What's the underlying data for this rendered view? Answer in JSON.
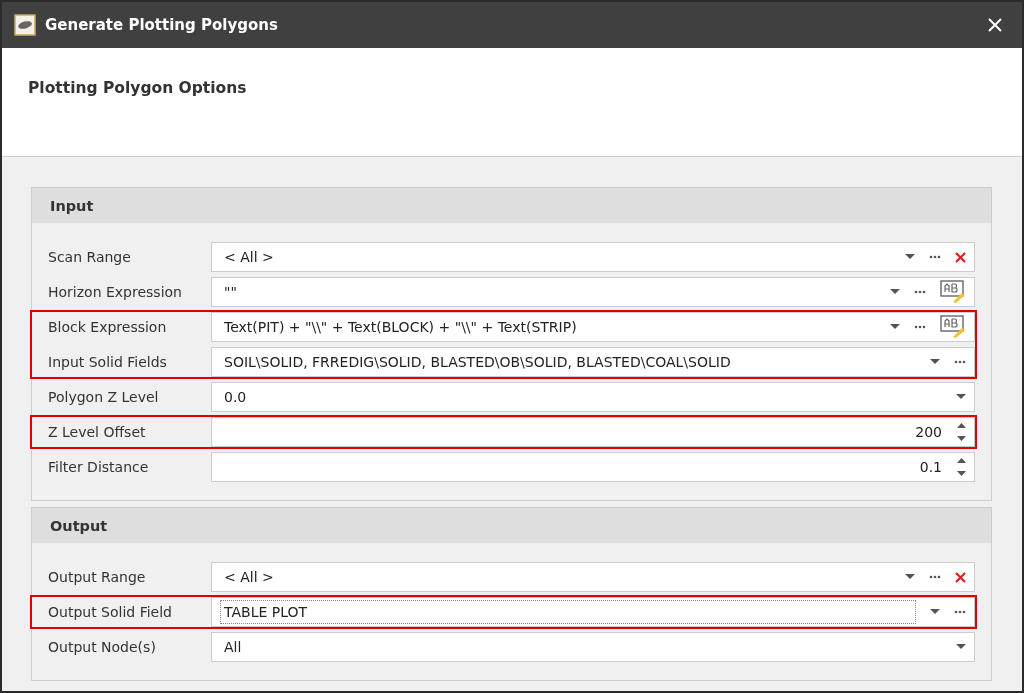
{
  "window": {
    "title": "Generate Plotting Polygons"
  },
  "header": {
    "title": "Plotting Polygon Options"
  },
  "sections": [
    {
      "title": "Input",
      "groups": [
        {
          "highlighted": false,
          "rows": [
            {
              "label": "Scan Range",
              "value": "< All >",
              "kind": "text",
              "focused": false,
              "buttons": [
                {
                  "kind": "dropdown"
                },
                {
                  "kind": "ellipsis"
                },
                {
                  "kind": "clear"
                }
              ]
            },
            {
              "label": "Horizon Expression",
              "value": "\"\"",
              "kind": "text",
              "focused": false,
              "buttons": [
                {
                  "kind": "dropdown"
                },
                {
                  "kind": "ellipsis"
                },
                {
                  "kind": "edit"
                }
              ]
            }
          ]
        },
        {
          "highlighted": true,
          "rows": [
            {
              "label": "Block Expression",
              "value": "Text(PIT) + \"\\\\\" + Text(BLOCK) + \"\\\\\" + Text(STRIP)",
              "kind": "text",
              "focused": false,
              "buttons": [
                {
                  "kind": "dropdown"
                },
                {
                  "kind": "ellipsis"
                },
                {
                  "kind": "edit"
                }
              ]
            },
            {
              "label": "Input Solid Fields",
              "value": "SOIL\\SOLID, FRREDIG\\SOLID, BLASTED\\OB\\SOLID, BLASTED\\COAL\\SOLID",
              "kind": "text",
              "focused": false,
              "buttons": [
                {
                  "kind": "dropdown"
                },
                {
                  "kind": "ellipsis"
                }
              ]
            }
          ]
        },
        {
          "highlighted": false,
          "rows": [
            {
              "label": "Polygon Z Level",
              "value": "0.0",
              "kind": "text",
              "focused": false,
              "buttons": [
                {
                  "kind": "dropdown"
                }
              ]
            }
          ]
        },
        {
          "highlighted": true,
          "rows": [
            {
              "label": "Z Level Offset",
              "value": "200",
              "kind": "number",
              "focused": false,
              "buttons": [
                {
                  "kind": "spin"
                }
              ]
            }
          ]
        },
        {
          "highlighted": false,
          "rows": [
            {
              "label": "Filter Distance",
              "value": "0.1",
              "kind": "number",
              "focused": false,
              "buttons": [
                {
                  "kind": "spin"
                }
              ]
            }
          ]
        }
      ]
    },
    {
      "title": "Output",
      "groups": [
        {
          "highlighted": false,
          "rows": [
            {
              "label": "Output Range",
              "value": "< All >",
              "kind": "text",
              "focused": false,
              "buttons": [
                {
                  "kind": "dropdown"
                },
                {
                  "kind": "ellipsis"
                },
                {
                  "kind": "clear"
                }
              ]
            }
          ]
        },
        {
          "highlighted": true,
          "rows": [
            {
              "label": "Output Solid Field",
              "value": "TABLE PLOT",
              "kind": "text",
              "focused": true,
              "buttons": [
                {
                  "kind": "dropdown"
                },
                {
                  "kind": "ellipsis"
                }
              ]
            }
          ]
        },
        {
          "highlighted": false,
          "rows": [
            {
              "label": "Output Node(s)",
              "value": "All",
              "kind": "text",
              "focused": false,
              "buttons": [
                {
                  "kind": "dropdown"
                }
              ]
            }
          ]
        }
      ]
    }
  ]
}
